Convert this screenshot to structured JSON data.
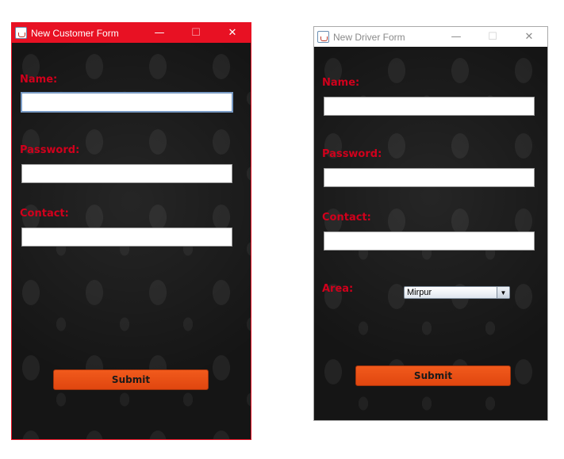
{
  "customer_form": {
    "title": "New Customer Form",
    "labels": {
      "name": "Name:",
      "password": "Password:",
      "contact": "Contact:"
    },
    "values": {
      "name": "",
      "password": "",
      "contact": ""
    },
    "submit_label": "Submit",
    "title_icon": "java-cup-icon"
  },
  "driver_form": {
    "title": "New Driver Form",
    "labels": {
      "name": "Name:",
      "password": "Password:",
      "contact": "Contact:",
      "area": "Area:"
    },
    "values": {
      "name": "",
      "password": "",
      "contact": ""
    },
    "area_selected": "Mirpur",
    "submit_label": "Submit",
    "title_icon": "java-cup-icon"
  },
  "window_controls": {
    "minimize": "—",
    "maximize": "☐",
    "close": "✕"
  },
  "colors": {
    "active_titlebar": "#e81123",
    "label_red": "#d1001c",
    "button_orange": "#f04e14",
    "background_dark": "#151515"
  }
}
